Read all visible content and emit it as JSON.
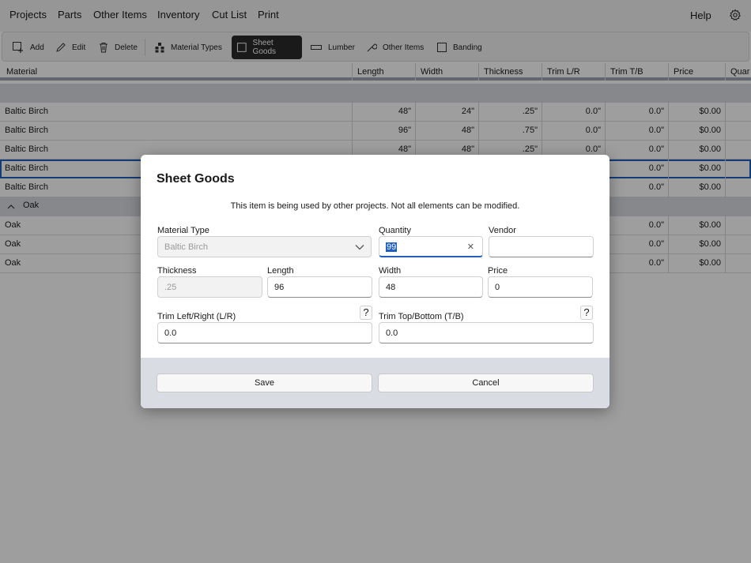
{
  "menu": {
    "items": [
      "Projects",
      "Parts",
      "Other Items",
      "Inventory",
      "Cut List",
      "Print"
    ],
    "help": "Help",
    "settings_icon": "gear-icon"
  },
  "toolbar": {
    "add": "Add",
    "edit": "Edit",
    "delete": "Delete",
    "material_types": "Material Types",
    "sheet_goods": "Sheet Goods",
    "lumber": "Lumber",
    "other_items": "Other Items",
    "banding": "Banding"
  },
  "table": {
    "columns": [
      "Material",
      "Length",
      "Width",
      "Thickness",
      "Trim L/R",
      "Trim T/B",
      "Price",
      "Quar"
    ],
    "groups": [
      {
        "label": "",
        "rows": [
          [
            "Baltic Birch",
            "48\"",
            "24\"",
            ".25\"",
            "0.0\"",
            "0.0\"",
            "$0.00"
          ],
          [
            "Baltic Birch",
            "96\"",
            "48\"",
            ".75\"",
            "0.0\"",
            "0.0\"",
            "$0.00"
          ],
          [
            "Baltic Birch",
            "48\"",
            "48\"",
            ".25\"",
            "0.0\"",
            "0.0\"",
            "$0.00"
          ],
          [
            "Baltic Birch",
            "",
            "",
            "",
            "",
            "0.0\"",
            "$0.00"
          ],
          [
            "Baltic Birch",
            "",
            "",
            "",
            "",
            "0.0\"",
            "$0.00"
          ]
        ]
      },
      {
        "label": "Oak",
        "rows": [
          [
            "Oak",
            "",
            "",
            "",
            "",
            "0.0\"",
            "$0.00"
          ],
          [
            "Oak",
            "",
            "",
            "",
            "",
            "0.0\"",
            "$0.00"
          ],
          [
            "Oak",
            "",
            "",
            "",
            "",
            "0.0\"",
            "$0.00"
          ]
        ]
      }
    ]
  },
  "dialog": {
    "title": "Sheet Goods",
    "message": "This item is being used by other projects.  Not all elements can be modified.",
    "material_type": {
      "label": "Material Type",
      "value": "Baltic Birch"
    },
    "quantity": {
      "label": "Quantity",
      "value": "99"
    },
    "vendor": {
      "label": "Vendor",
      "value": ""
    },
    "thickness": {
      "label": "Thickness",
      "value": ".25"
    },
    "length": {
      "label": "Length",
      "value": "96"
    },
    "width": {
      "label": "Width",
      "value": "48"
    },
    "price": {
      "label": "Price",
      "value": "0"
    },
    "trim_lr": {
      "label": "Trim Left/Right (L/R)",
      "value": "0.0",
      "help": "?"
    },
    "trim_tb": {
      "label": "Trim Top/Bottom (T/B)",
      "value": "0.0",
      "help": "?"
    },
    "clear_glyph": "✕",
    "save": "Save",
    "cancel": "Cancel"
  }
}
